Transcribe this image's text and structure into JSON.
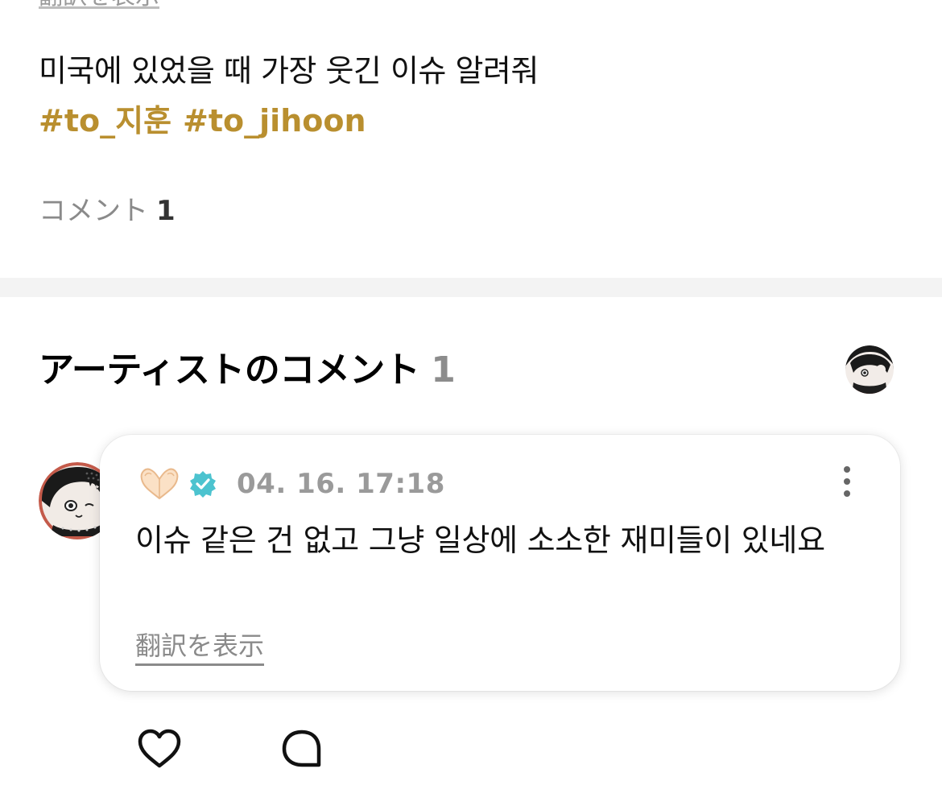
{
  "post": {
    "top_link_cut": "翻訳を表示",
    "text": "미국에 있었을 때 가장 웃긴 이슈 알려줘",
    "hashtags": [
      "#to_지훈",
      "#to_jihoon"
    ],
    "comments_label": "コメント",
    "comments_count": "1"
  },
  "artist_section": {
    "title": "アーティストのコメント",
    "count": "1"
  },
  "comment": {
    "emoji_icon": "heart-hands-icon",
    "verified_icon": "verified-badge-icon",
    "timestamp": "04. 16. 17:18",
    "text": "이슈 같은 건 없고 그냥 일상에 소소한 재미들이 있네요",
    "translate_label": "翻訳を表示"
  },
  "actions": {
    "like_icon": "heart-outline-icon",
    "reply_icon": "speech-bubble-icon"
  },
  "colors": {
    "hashtag": "#b98f2f",
    "muted": "#8a8a8a",
    "verified": "#4cc3cf",
    "divider": "#f3f3f3"
  }
}
